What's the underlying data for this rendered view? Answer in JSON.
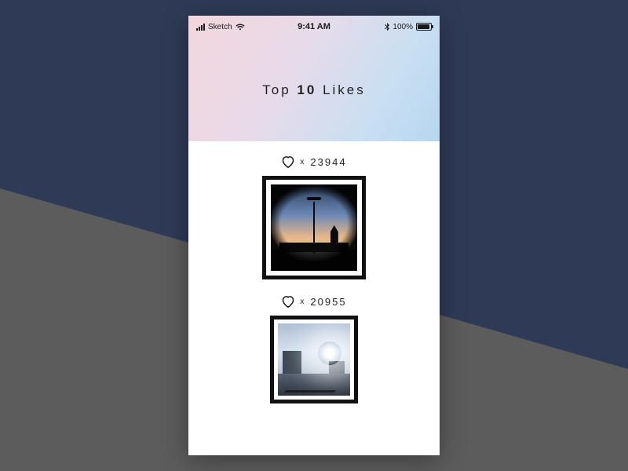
{
  "status": {
    "carrier": "Sketch",
    "time": "9:41 AM",
    "battery_pct": "100%"
  },
  "title": {
    "prefix": "Top",
    "number": "10",
    "suffix": "Likes"
  },
  "x_glyph": "x",
  "posts": [
    {
      "likes": "23944"
    },
    {
      "likes": "20955"
    }
  ]
}
